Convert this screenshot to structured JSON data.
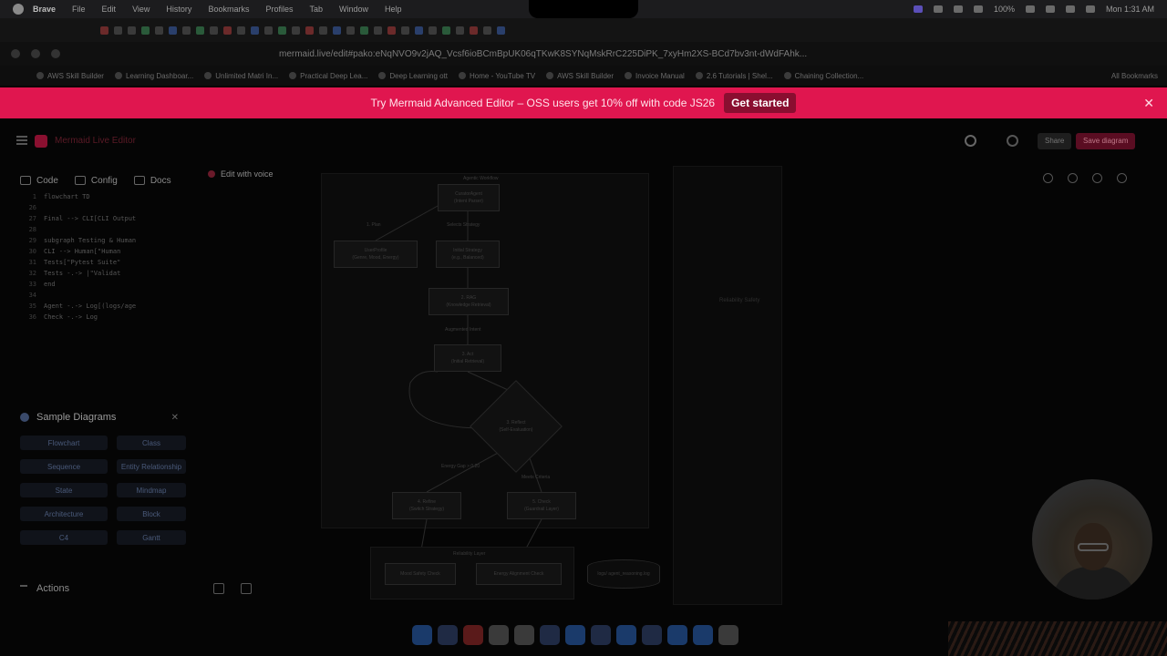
{
  "macbar": {
    "app": "Brave",
    "menu": [
      "File",
      "Edit",
      "View",
      "History",
      "Bookmarks",
      "Profiles",
      "Tab",
      "Window",
      "Help"
    ],
    "battery": "100%",
    "clock": "Mon 1:31 AM"
  },
  "browser": {
    "url": "mermaid.live/edit#pako:eNqNVO9v2jAQ_Vcsf6ioBCmBpUK06qTKwK8SYNqMskRrC225DiPK_7xyHm2XS-BCd7bv3nt-dWdFAhk...",
    "bookmarks": [
      "AWS Skill Builder",
      "Learning Dashboar...",
      "Unlimited Matri In...",
      "Practical Deep Lea...",
      "Deep Learning ott",
      "Home - YouTube TV",
      "AWS Skill Builder",
      "Invoice Manual",
      "2.6 Tutorials | Shel...",
      "Chaining Collection..."
    ],
    "all_bookmarks": "All Bookmarks"
  },
  "promo": {
    "text": "Try Mermaid Advanced Editor – OSS users get 10% off with code JS26",
    "cta": "Get started",
    "close": "✕"
  },
  "header": {
    "brand": "Mermaid Live Editor",
    "share": "Share",
    "save": "Save diagram"
  },
  "editor": {
    "tabs": [
      "Code",
      "Config",
      "Docs"
    ],
    "voice": "Edit with voice",
    "lines": [
      {
        "n": "1",
        "t": "flowchart TD"
      },
      {
        "n": "26",
        "t": ""
      },
      {
        "n": "27",
        "t": "    Final --> CLI[CLI Output"
      },
      {
        "n": "28",
        "t": ""
      },
      {
        "n": "29",
        "t": "    subgraph Testing & Human"
      },
      {
        "n": "30",
        "t": "       CLI --> Human[\"Human"
      },
      {
        "n": "31",
        "t": "       Tests[\"Pytest Suite\""
      },
      {
        "n": "32",
        "t": "       Tests -.-> |\"Validat"
      },
      {
        "n": "33",
        "t": "    end"
      },
      {
        "n": "34",
        "t": ""
      },
      {
        "n": "35",
        "t": "    Agent -.-> Log[(logs/age"
      },
      {
        "n": "36",
        "t": "    Check -.-> Log"
      }
    ]
  },
  "samples": {
    "title": "Sample Diagrams",
    "chevron": "✕",
    "items": [
      "Flowchart",
      "Class",
      "Sequence",
      "Entity Relationship",
      "State",
      "Mindmap",
      "Architecture",
      "Block",
      "C4",
      "Gantt"
    ]
  },
  "actions": {
    "label": "Actions"
  },
  "diagram": {
    "title": "Agentic Workflow",
    "nodes": {
      "curator": [
        "CuratorAgent",
        "(Intent Parser)"
      ],
      "profile": [
        "UserProfile",
        "(Genre, Mood, Energy)"
      ],
      "strategy": [
        "Initial Strategy",
        "(e.g., Balanced)"
      ],
      "rag": [
        "2. RAG",
        "(Knowledge Retrieval)"
      ],
      "act": [
        "3. Act",
        "(Initial Retrieval)"
      ],
      "reflect": [
        "3. Reflect",
        "(Self-Evaluation)"
      ],
      "refine": [
        "4. Refine",
        "(Switch Strategy)"
      ],
      "check": [
        "5. Check",
        "(Guardrail Layer)"
      ]
    },
    "edges": {
      "plan": "1. Plan",
      "select": "Selects Strategy",
      "augmented": "Augmented Intent",
      "energy": "Energy Gap > 0.20",
      "meets": "Meets Criteria"
    },
    "reliability": {
      "title": "Reliability Layer",
      "mood": "Mood Safety Check",
      "energy": "Energy Alignment Check"
    },
    "log": "logs/ agent_reasoning.log",
    "side_label": "Reliability Safety"
  }
}
